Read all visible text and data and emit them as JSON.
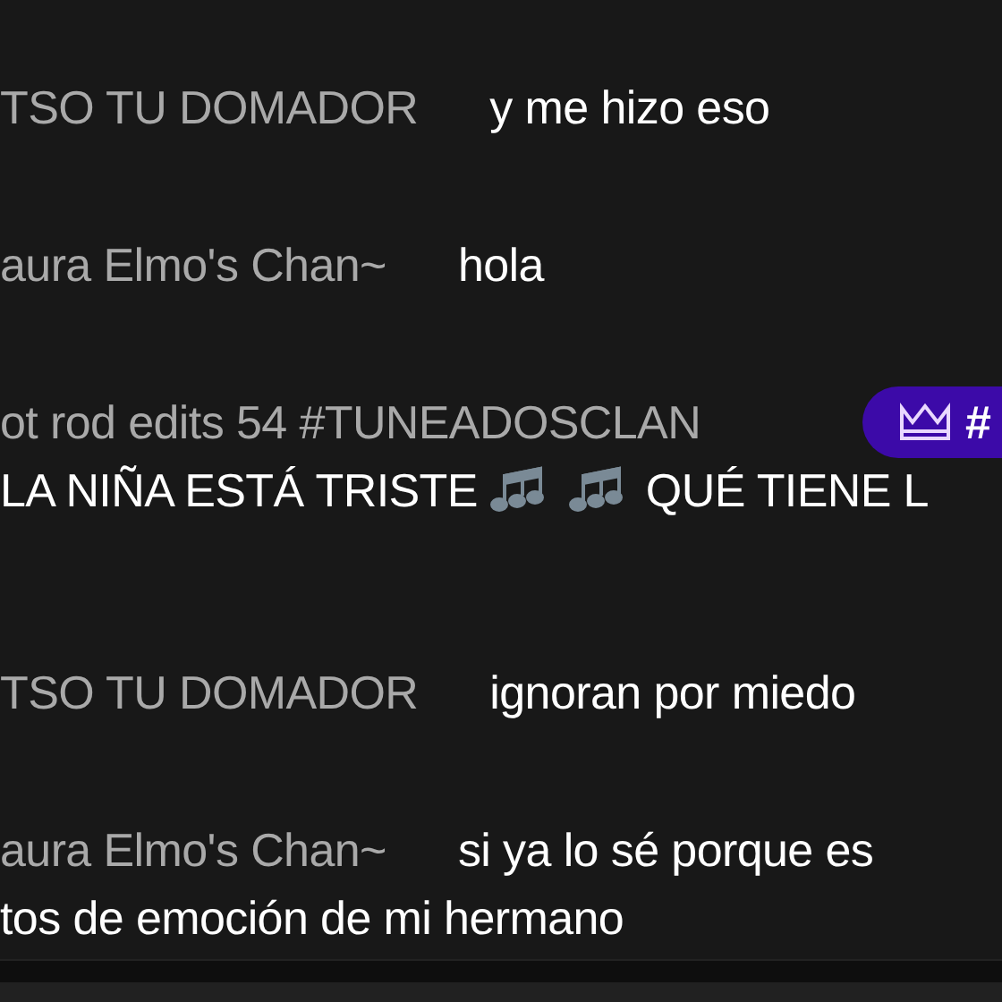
{
  "chat_messages": [
    {
      "author": "TSO TU DOMADOR",
      "lines": [
        "y me hizo eso"
      ]
    },
    {
      "author": "aura Elmo's Chan~",
      "lines": [
        "hola"
      ]
    },
    {
      "author": "ot rod edits 54 #TUNEADOSCLAN",
      "badge": {
        "text": "#"
      },
      "parts": [
        {
          "kind": "text",
          "text": "LA NIÑA ESTÁ TRISTE"
        },
        {
          "kind": "notes"
        },
        {
          "kind": "notes"
        },
        {
          "kind": "text",
          "text": "QUÉ TIENE L"
        }
      ]
    },
    {
      "author": "TSO TU DOMADOR",
      "lines": [
        "ignoran por miedo"
      ]
    },
    {
      "author": "aura Elmo's Chan~",
      "lines": [
        "si ya lo sé porque es",
        "tos de emoción de mi hermano"
      ]
    }
  ]
}
